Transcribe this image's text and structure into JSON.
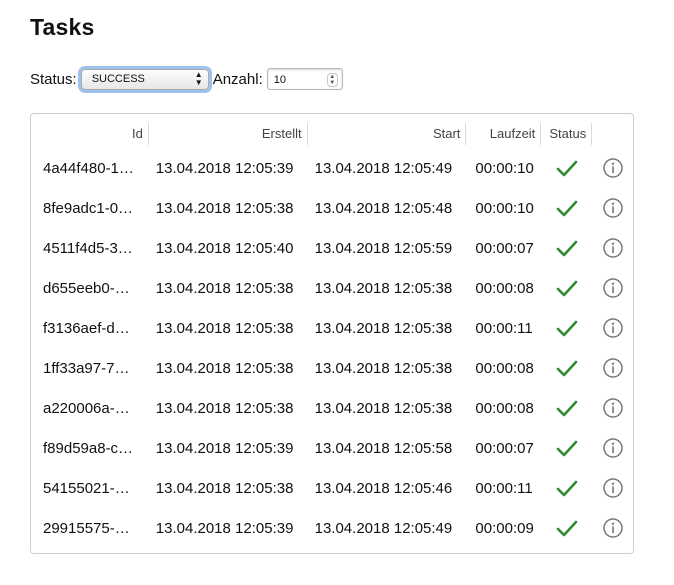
{
  "page": {
    "title": "Tasks"
  },
  "filters": {
    "status_label": "Status:",
    "status_value": "SUCCESS",
    "count_label": "Anzahl:",
    "count_value": "10"
  },
  "table": {
    "headers": {
      "id": "Id",
      "created": "Erstellt",
      "start": "Start",
      "duration": "Laufzeit",
      "status": "Status"
    },
    "rows": [
      {
        "id": "4a44f480-1…",
        "created": "13.04.2018 12:05:39",
        "start": "13.04.2018 12:05:49",
        "duration": "00:00:10",
        "status_icon": "check-icon"
      },
      {
        "id": "8fe9adc1-0…",
        "created": "13.04.2018 12:05:38",
        "start": "13.04.2018 12:05:48",
        "duration": "00:00:10",
        "status_icon": "check-icon"
      },
      {
        "id": "4511f4d5-3…",
        "created": "13.04.2018 12:05:40",
        "start": "13.04.2018 12:05:59",
        "duration": "00:00:07",
        "status_icon": "check-icon"
      },
      {
        "id": "d655eeb0-…",
        "created": "13.04.2018 12:05:38",
        "start": "13.04.2018 12:05:38",
        "duration": "00:00:08",
        "status_icon": "check-icon"
      },
      {
        "id": "f3136aef-d…",
        "created": "13.04.2018 12:05:38",
        "start": "13.04.2018 12:05:38",
        "duration": "00:00:11",
        "status_icon": "check-icon"
      },
      {
        "id": "1ff33a97-7…",
        "created": "13.04.2018 12:05:38",
        "start": "13.04.2018 12:05:38",
        "duration": "00:00:08",
        "status_icon": "check-icon"
      },
      {
        "id": "a220006a-…",
        "created": "13.04.2018 12:05:38",
        "start": "13.04.2018 12:05:38",
        "duration": "00:00:08",
        "status_icon": "check-icon"
      },
      {
        "id": "f89d59a8-c…",
        "created": "13.04.2018 12:05:39",
        "start": "13.04.2018 12:05:58",
        "duration": "00:00:07",
        "status_icon": "check-icon"
      },
      {
        "id": "54155021-…",
        "created": "13.04.2018 12:05:38",
        "start": "13.04.2018 12:05:46",
        "duration": "00:00:11",
        "status_icon": "check-icon"
      },
      {
        "id": "29915575-…",
        "created": "13.04.2018 12:05:39",
        "start": "13.04.2018 12:05:49",
        "duration": "00:00:09",
        "status_icon": "check-icon"
      }
    ]
  },
  "colors": {
    "check": "#2e8b2e",
    "info_icon": "#777777",
    "focus_ring": "#9fc1ee"
  }
}
